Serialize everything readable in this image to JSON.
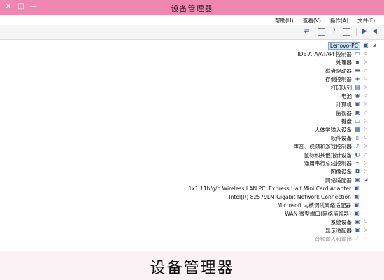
{
  "window": {
    "title": "设备管理器",
    "controls": [
      "✕",
      "□",
      "—"
    ]
  },
  "menu": {
    "items": [
      "文件(F)",
      "操作(A)",
      "查看(V)",
      "帮助(H)"
    ]
  },
  "toolbar": {
    "icons": [
      "back-icon",
      "forward-icon",
      "properties-icon",
      "help-icon",
      "show-hide-icon",
      "scan-icon"
    ]
  },
  "tree": {
    "root": "Lenovo-PC",
    "categories": [
      "IDE ATA/ATAPI 控制器",
      "处理器",
      "磁盘驱动器",
      "存储控制器",
      "打印队列",
      "电池",
      "计算机",
      "监视器",
      "键盘",
      "人体学输入设备",
      "软件设备",
      "声音、视频和游戏控制器",
      "鼠标和其他指针设备",
      "通用串行总线控制器",
      "图像设备",
      "网络适配器"
    ],
    "network_adapters": [
      "1x1 11b/g/n Wireless LAN PCI Express Half Mini Card Adapter",
      "Intel(R) 82579LM Gigabit Network Connection",
      "Microsoft 内核调试网络适配器",
      "WAN 微型端口(网络监视器)"
    ],
    "more_categories": [
      "系统设备",
      "显示适配器",
      "音频输入和输出"
    ]
  },
  "caption": "设备管理器"
}
